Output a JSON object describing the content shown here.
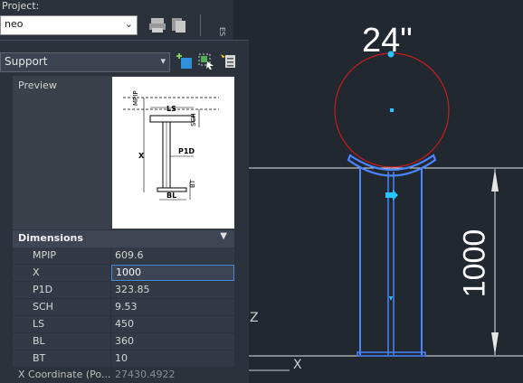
{
  "project": {
    "label": "Project:",
    "combo_value": "neo"
  },
  "properties": {
    "type_combo_value": "Support",
    "preview_label": "Preview",
    "preview_labels": {
      "mpip": "MPIP",
      "ls": "LS",
      "sch": "SCH",
      "p1d": "P1D",
      "x": "X",
      "bl": "BL",
      "bt": "BT"
    },
    "dimensions_header": "Dimensions",
    "rows": [
      {
        "name": "MPIP",
        "value": "609.6"
      },
      {
        "name": "X",
        "value": "1000"
      },
      {
        "name": "P1D",
        "value": "323.85"
      },
      {
        "name": "SCH",
        "value": "9.53"
      },
      {
        "name": "LS",
        "value": "450"
      },
      {
        "name": "BL",
        "value": "360"
      },
      {
        "name": "BT",
        "value": "10"
      }
    ],
    "status_label": "X Coordinate (Po...",
    "status_value": "27430.4922"
  },
  "drawing": {
    "pipe_size_label": "24\"",
    "dimension_label": "1000",
    "ucs_z": "Z",
    "ucs_x": "X"
  },
  "icons": [
    "print-icon",
    "copy-icon",
    "add-icon",
    "select-objects-icon",
    "quick-select-icon",
    "collapse-arrow-icon"
  ],
  "colors": {
    "pipe_circle": "#c81e1e",
    "support_selected": "#4a86ff",
    "grip": "#26c6ff",
    "background": "#212830"
  }
}
